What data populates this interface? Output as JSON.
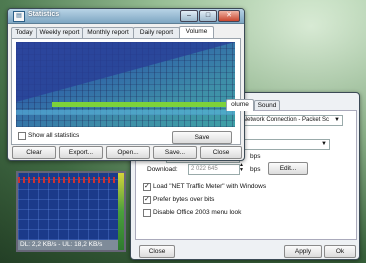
{
  "statistics_window": {
    "title": "Statistics",
    "tabs": [
      "Today",
      "Weekly report",
      "Monthly report",
      "Daily report",
      "Volume"
    ],
    "active_tab": "Volume",
    "show_all_label": "Show all statistics",
    "save_label": "Save",
    "buttons": [
      "Clear",
      "Export...",
      "Open...",
      "Save...",
      "Close"
    ]
  },
  "mini_graph": {
    "readout": "DL: 2,2 KB/s - UL: 18,2 KB/s"
  },
  "options_window": {
    "tabs": [
      "olume",
      "Sound"
    ],
    "adapter": "PM Network Connection - Packet Sc",
    "download_label": "Download:",
    "download_value": "2 022 645",
    "bps_unit": "bps",
    "bps_unit_2": "bps",
    "edit_label": "Edit...",
    "checkboxes": [
      {
        "label": "Load \"NET Traffic Meter\" with Windows",
        "checked": true
      },
      {
        "label": "Prefer bytes over bits",
        "checked": true
      },
      {
        "label": "Disable Office 2003 menu look",
        "checked": false
      }
    ],
    "close_label": "Close",
    "apply_label": "Apply",
    "ok_label": "Ok"
  }
}
